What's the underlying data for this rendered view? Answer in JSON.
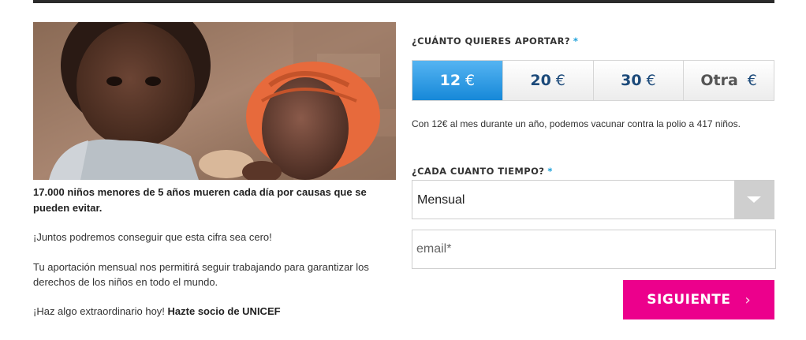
{
  "hero": {
    "image": "child-holding-doll-photo"
  },
  "left": {
    "headline": "17.000 niños menores de 5 años mueren cada día por causas que se pueden evitar.",
    "paragraph_1": "¡Juntos podremos conseguir que esta cifra sea cero!",
    "paragraph_2": "Tu aportación mensual nos permitirá seguir trabajando para garantizar los derechos de los niños en todo el mundo.",
    "paragraph_3_prefix": "¡Haz algo extraordinario hoy! ",
    "paragraph_3_bold": "Hazte socio de UNICEF"
  },
  "form": {
    "amount_label": "¿CUÁNTO QUIERES APORTAR?",
    "required_mark": "*",
    "amounts": [
      {
        "value": "12",
        "currency": "€",
        "selected": true
      },
      {
        "value": "20",
        "currency": "€",
        "selected": false
      },
      {
        "value": "30",
        "currency": "€",
        "selected": false
      },
      {
        "value": "Otra",
        "currency": "€",
        "selected": false
      }
    ],
    "impact_text": "Con 12€ al mes durante un año, podemos vacunar contra la polio a 417 niños.",
    "frequency_label": "¿CADA CUANTO TIEMPO?",
    "frequency_value": "Mensual",
    "email_placeholder": "email*",
    "next_button": "SIGUIENTE",
    "next_icon": "chevron-right-icon"
  },
  "colors": {
    "accent_blue": "#1688d8",
    "button_pink": "#ec008c",
    "required_blue": "#1a9fd9"
  }
}
